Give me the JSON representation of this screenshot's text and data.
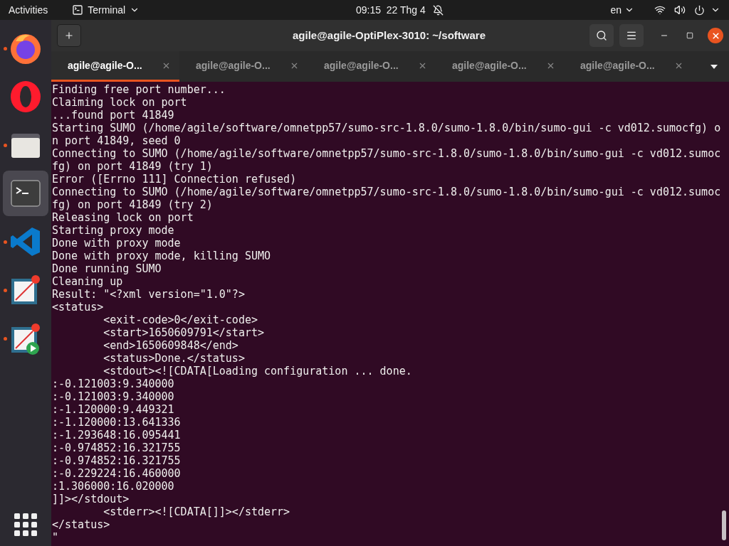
{
  "top_bar": {
    "activities": "Activities",
    "app_menu": "Terminal",
    "clock": "09:15  22 Thg 4",
    "notifications_muted": true,
    "language": "en"
  },
  "dock": {
    "items": [
      {
        "kind": "firefox",
        "running": true,
        "selected": false
      },
      {
        "kind": "opera",
        "running": false,
        "selected": false
      },
      {
        "kind": "files",
        "running": true,
        "selected": false
      },
      {
        "kind": "terminal",
        "running": false,
        "selected": true
      },
      {
        "kind": "vscode",
        "running": true,
        "selected": false
      },
      {
        "kind": "plot",
        "running": true,
        "selected": false
      },
      {
        "kind": "plot-run",
        "running": true,
        "selected": false
      }
    ]
  },
  "window": {
    "title": "agile@agile-OptiPlex-3010: ~/software"
  },
  "tabs": [
    {
      "label": "agile@agile-O...",
      "selected": true
    },
    {
      "label": "agile@agile-O...",
      "selected": false
    },
    {
      "label": "agile@agile-O...",
      "selected": false
    },
    {
      "label": "agile@agile-O...",
      "selected": false
    },
    {
      "label": "agile@agile-O...",
      "selected": false
    }
  ],
  "terminal": {
    "lines": [
      "Finding free port number...",
      "Claiming lock on port",
      "...found port 41849",
      "Starting SUMO (/home/agile/software/omnetpp57/sumo-src-1.8.0/sumo-1.8.0/bin/sumo-gui -c vd012.sumocfg) o",
      "n port 41849, seed 0",
      "Connecting to SUMO (/home/agile/software/omnetpp57/sumo-src-1.8.0/sumo-1.8.0/bin/sumo-gui -c vd012.sumoc",
      "fg) on port 41849 (try 1)",
      "Error ([Errno 111] Connection refused)",
      "Connecting to SUMO (/home/agile/software/omnetpp57/sumo-src-1.8.0/sumo-1.8.0/bin/sumo-gui -c vd012.sumoc",
      "fg) on port 41849 (try 2)",
      "Releasing lock on port",
      "Starting proxy mode",
      "Done with proxy mode",
      "Done with proxy mode, killing SUMO",
      "Done running SUMO",
      "Cleaning up",
      "Result: \"<?xml version=\"1.0\"?>",
      "<status>",
      "\t<exit-code>0</exit-code>",
      "\t<start>1650609791</start>",
      "\t<end>1650609848</end>",
      "\t<status>Done.</status>",
      "\t<stdout><![CDATA[Loading configuration ... done.",
      ":-0.121003:9.340000",
      ":-0.121003:9.340000",
      ":-1.120000:9.449321",
      ":-1.120000:13.641336",
      ":-1.293648:16.095441",
      ":-0.974852:16.321755",
      ":-0.974852:16.321755",
      ":-0.229224:16.460000",
      ":1.306000:16.020000",
      "]]></stdout>",
      "\t<stderr><![CDATA[]]></stderr>",
      "</status>",
      "\""
    ]
  }
}
